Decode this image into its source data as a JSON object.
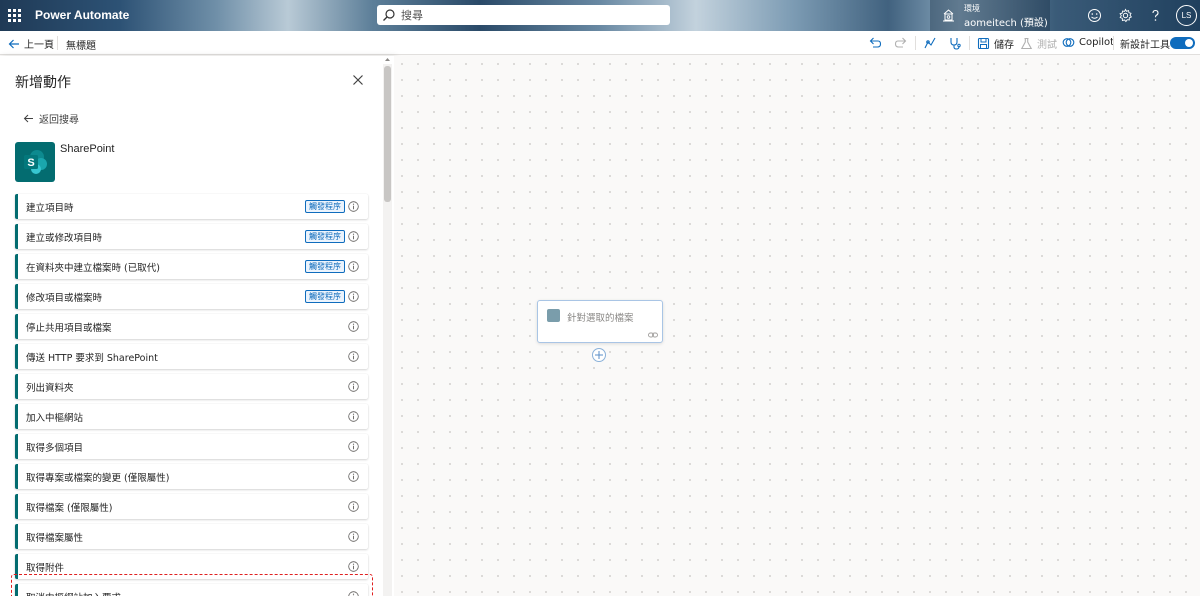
{
  "header": {
    "app_title": "Power Automate",
    "search_placeholder": "搜尋",
    "environment_label": "環境",
    "environment_name": "aomeitech (預設)",
    "avatar_initials": "LS",
    "icons": [
      "app-launcher-icon",
      "environment-icon",
      "smiley-icon",
      "gear-icon",
      "help-icon"
    ]
  },
  "toolbar": {
    "back_label": "上一頁",
    "flow_title": "無標題",
    "save_label": "儲存",
    "test_label": "測試",
    "copilot_label": "Copilot",
    "new_designer_label": "新設計工具",
    "new_designer_enabled": true
  },
  "panel": {
    "title": "新增動作",
    "back_to_search": "返回搜尋",
    "connector_name": "SharePoint",
    "connector_color": "#036c70",
    "badge_label": "觸發程序",
    "items": [
      {
        "label": "建立項目時",
        "trigger": true
      },
      {
        "label": "建立或修改項目時",
        "trigger": true
      },
      {
        "label": "在資料夾中建立檔案時 (已取代)",
        "trigger": true
      },
      {
        "label": "修改項目或檔案時",
        "trigger": true
      },
      {
        "label": "停止共用項目或檔案",
        "trigger": false
      },
      {
        "label": "傳送 HTTP 要求到 SharePoint",
        "trigger": false
      },
      {
        "label": "列出資料夾",
        "trigger": false
      },
      {
        "label": "加入中樞網站",
        "trigger": false
      },
      {
        "label": "取得多個項目",
        "trigger": false
      },
      {
        "label": "取得專案或檔案的變更 (僅限屬性)",
        "trigger": false
      },
      {
        "label": "取得檔案 (僅限屬性)",
        "trigger": false
      },
      {
        "label": "取得檔案屬性",
        "trigger": false
      },
      {
        "label": "取得附件",
        "trigger": false
      },
      {
        "label": "取消中樞網站加入要求",
        "trigger": false
      }
    ],
    "highlighted_item": "取得檔案屬性",
    "highlight_color": "#e02020"
  },
  "canvas": {
    "node_label": "針對選取的檔案",
    "node_border_color": "#a9c5e5"
  },
  "colors": {
    "accent": "#0f6cbd",
    "sharepoint": "#036c70"
  }
}
